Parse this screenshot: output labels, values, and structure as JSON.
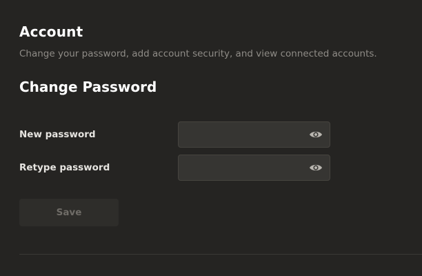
{
  "account": {
    "title": "Account",
    "description": "Change your password, add account security, and view connected accounts."
  },
  "change_password": {
    "title": "Change Password",
    "fields": [
      {
        "label": "New password",
        "value": "",
        "icon": "eye-icon"
      },
      {
        "label": "Retype password",
        "value": "",
        "icon": "eye-icon"
      }
    ],
    "save_label": "Save",
    "save_enabled": false
  },
  "colors": {
    "background": "#252422",
    "input_background": "#363532",
    "muted_text": "#8f8c87",
    "button_background": "#2e2d2a",
    "button_text_disabled": "#6f6c67"
  }
}
